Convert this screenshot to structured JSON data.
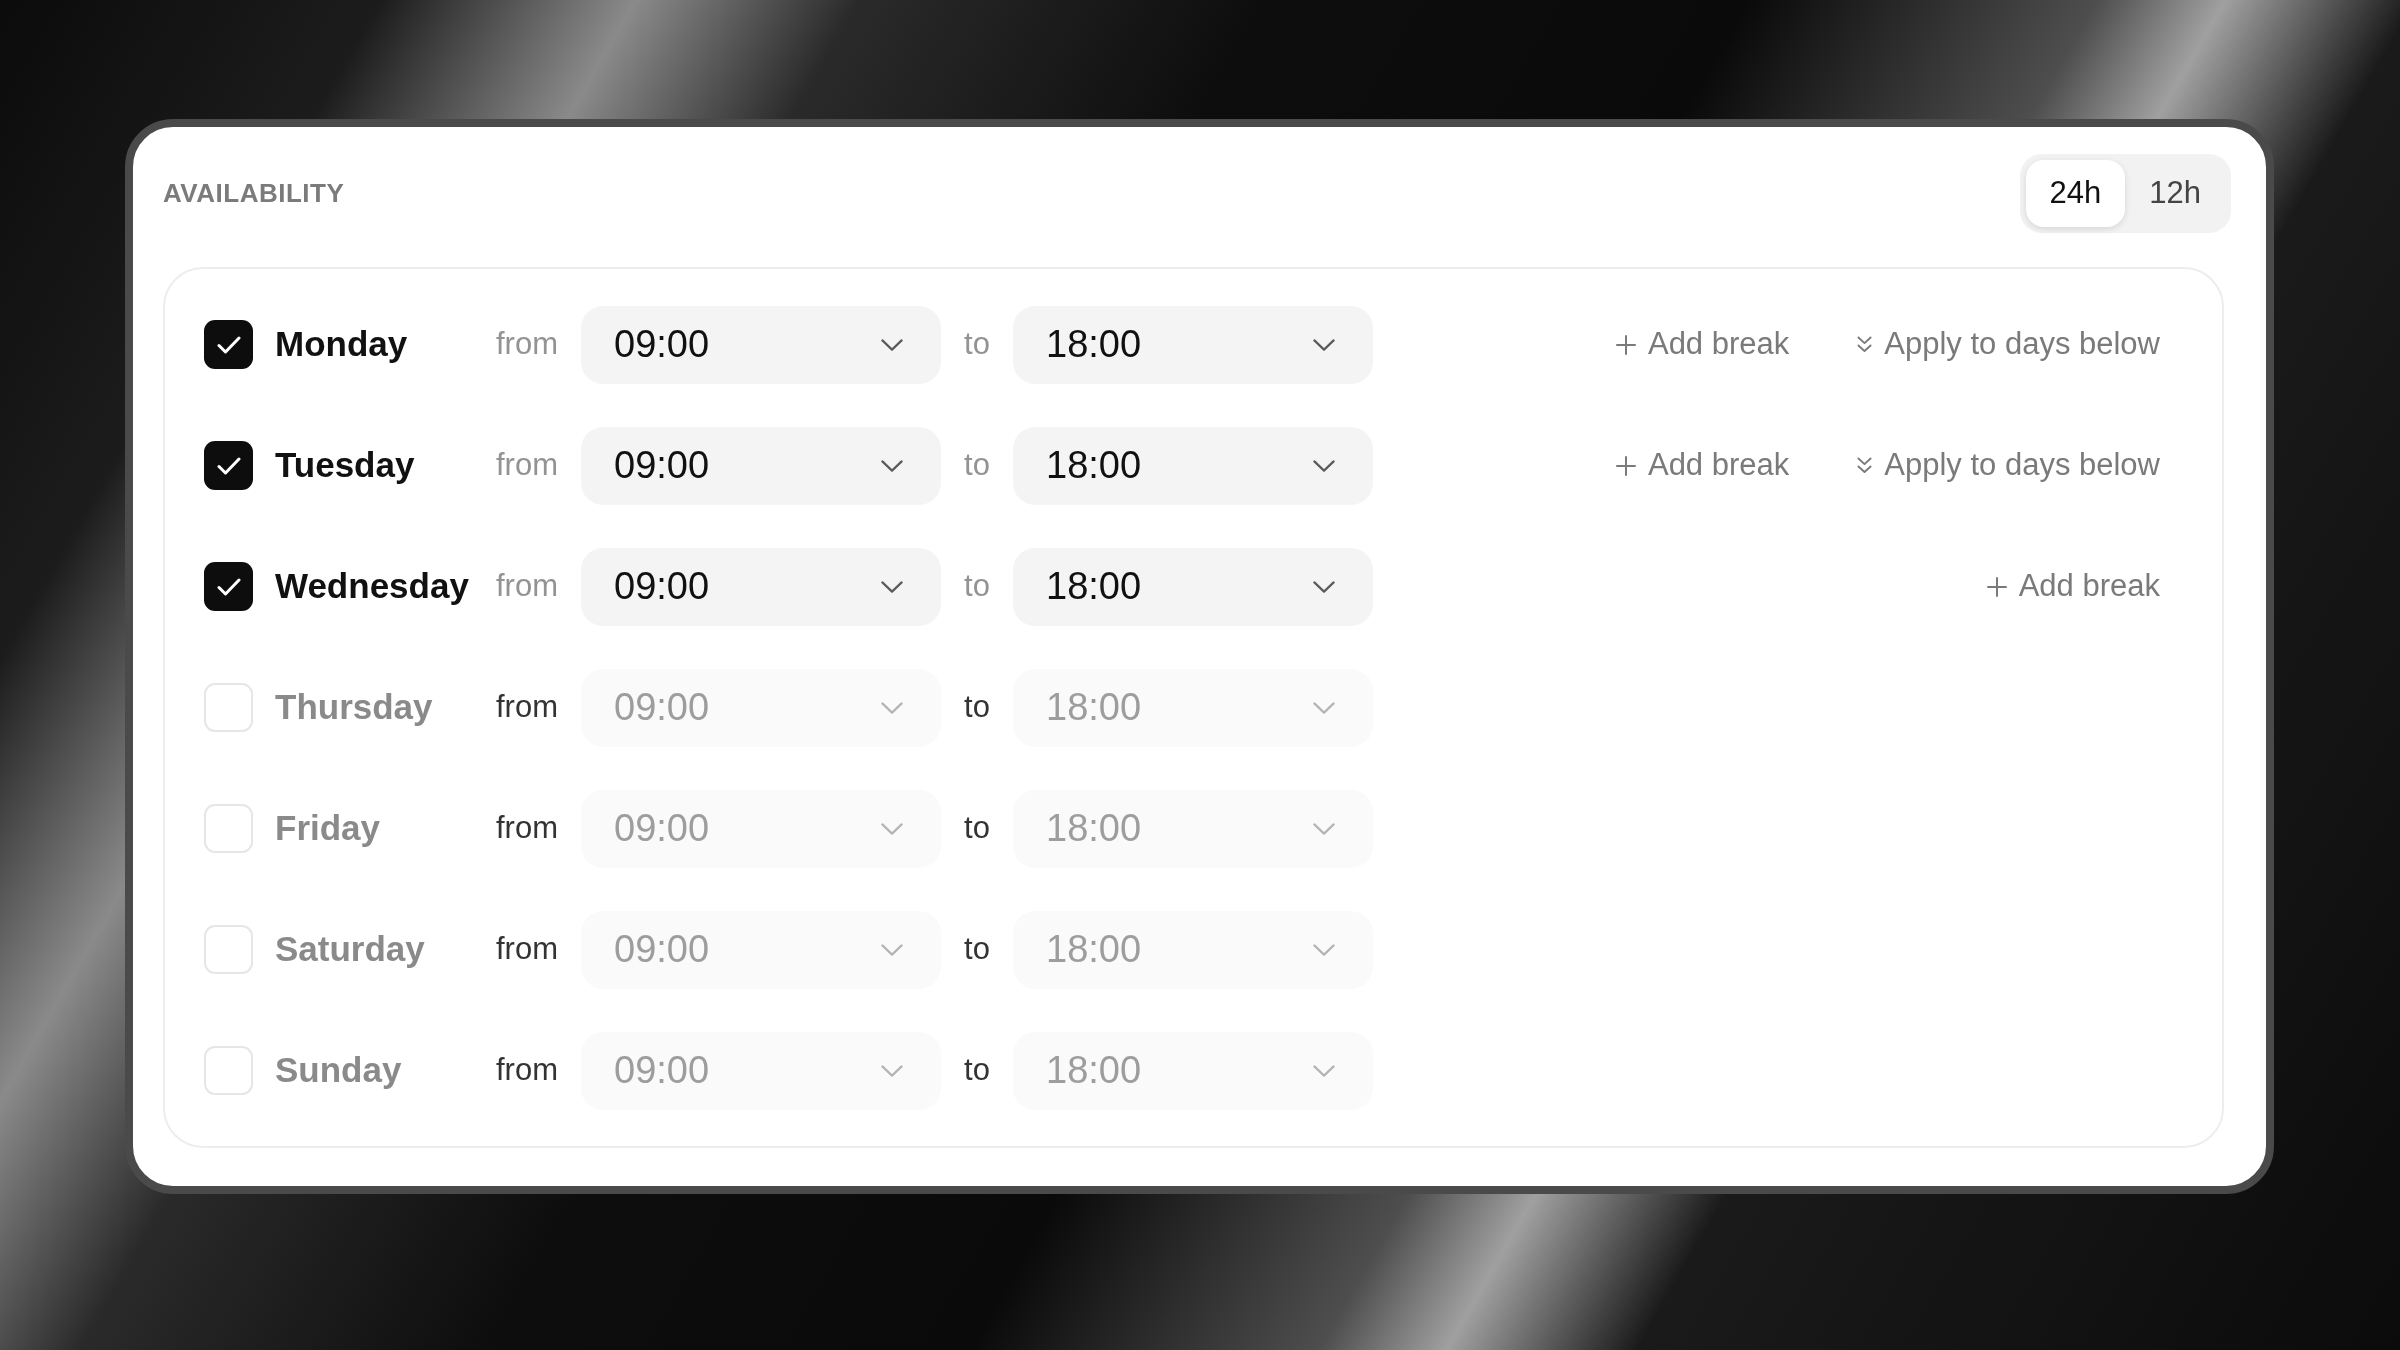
{
  "title": "AVAILABILITY",
  "time_format": [
    {
      "label": "24h",
      "selected": true
    },
    {
      "label": "12h",
      "selected": false
    }
  ],
  "days": [
    {
      "name": "Monday",
      "checked": true,
      "from_label": "from",
      "from": "09:00",
      "to_label": "to",
      "to": "18:00",
      "actions": [
        {
          "kind": "add_break",
          "label": "Add break"
        },
        {
          "kind": "apply_below",
          "label": "Apply to days below"
        }
      ]
    },
    {
      "name": "Tuesday",
      "checked": true,
      "from_label": "from",
      "from": "09:00",
      "to_label": "to",
      "to": "18:00",
      "actions": [
        {
          "kind": "add_break",
          "label": "Add break"
        },
        {
          "kind": "apply_below",
          "label": "Apply to days below"
        }
      ]
    },
    {
      "name": "Wednesday",
      "checked": true,
      "from_label": "from",
      "from": "09:00",
      "to_label": "to",
      "to": "18:00",
      "actions": [
        {
          "kind": "add_break",
          "label": "Add break"
        }
      ]
    },
    {
      "name": "Thursday",
      "checked": false,
      "from_label": "from",
      "from": "09:00",
      "to_label": "to",
      "to": "18:00"
    },
    {
      "name": "Friday",
      "checked": false,
      "from_label": "from",
      "from": "09:00",
      "to_label": "to",
      "to": "18:00"
    },
    {
      "name": "Saturday",
      "checked": false,
      "from_label": "from",
      "from": "09:00",
      "to_label": "to",
      "to": "18:00"
    },
    {
      "name": "Sunday",
      "checked": false,
      "from_label": "from",
      "from": "09:00",
      "to_label": "to",
      "to": "18:00"
    }
  ]
}
